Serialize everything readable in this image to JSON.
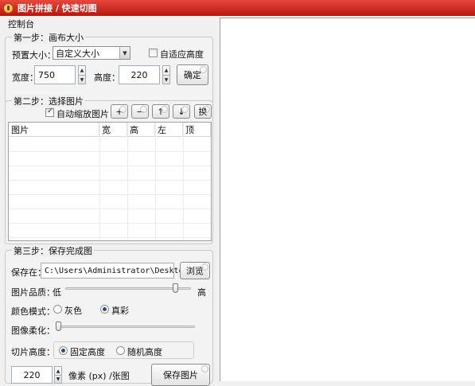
{
  "window": {
    "title": "图片拼接 / 快速切图"
  },
  "panel": {
    "title": "控制台"
  },
  "step1": {
    "title": "第一步：画布大小",
    "preset_label": "预置大小：",
    "preset_value": "自定义大小",
    "auto_height_label": "自适应高度",
    "auto_height_checked": false,
    "width_label": "宽度：",
    "width_value": "750",
    "height_label": "高度：",
    "height_value": "220",
    "confirm_label": "确定"
  },
  "step2": {
    "title": "第二步：选择图片",
    "auto_scale_label": "自动缩放图片",
    "auto_scale_checked": true,
    "tool_add": "+",
    "tool_remove": "−",
    "tool_up": "↑",
    "tool_down": "↓",
    "tool_swap": "换",
    "columns": [
      "图片",
      "宽",
      "高",
      "左",
      "顶"
    ]
  },
  "step3": {
    "title": "第三步：保存完成图",
    "save_to_label": "保存在：",
    "save_path": "C:\\Users\\Administrator\\Desktop",
    "browse_label": "浏览",
    "quality_label": "图片品质：",
    "quality_low": "低",
    "quality_high": "高",
    "quality_level": 0.9,
    "color_mode_label": "颜色模式：",
    "color_gray": "灰色",
    "color_true": "真彩",
    "soften_label": "图像柔化：",
    "slice_height_label": "切片高度：",
    "slice_fixed": "固定高度",
    "slice_random": "随机高度",
    "slice_value": "220",
    "slice_unit": "像素 (px) /张图",
    "save_button_label": "保存图片"
  },
  "colors": {
    "title_bar": "#c8211a",
    "canvas": "#ffffff"
  }
}
